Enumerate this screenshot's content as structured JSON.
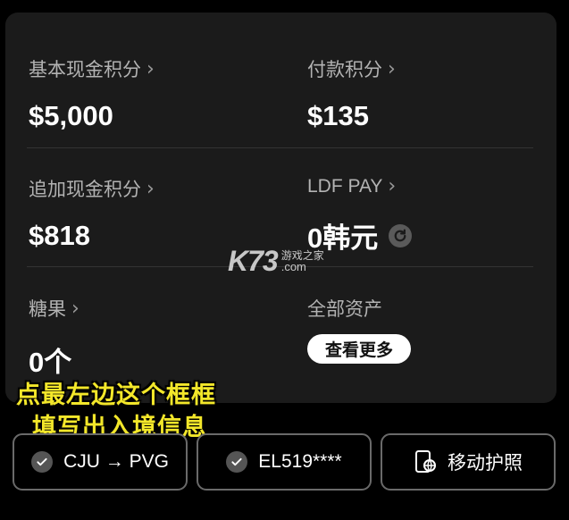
{
  "points": {
    "basic_cash": {
      "label": "基本现金积分",
      "value": "$5,000"
    },
    "payment": {
      "label": "付款积分",
      "value": "$135"
    },
    "additional_cash": {
      "label": "追加现金积分",
      "value": "$818"
    },
    "ldf_pay": {
      "label": "LDF PAY",
      "value": "0韩元"
    },
    "candy": {
      "label": "糖果",
      "value": "0个"
    },
    "all_assets": {
      "label": "全部资产",
      "button_label": "查看更多"
    }
  },
  "overlay": {
    "line1": "点最左边这个框框",
    "line2": "填写出入境信息"
  },
  "watermark": {
    "logo": "K73",
    "cn": "游戏之家",
    "com": ".com"
  },
  "buttons": {
    "route": {
      "label": "CJU → PVG"
    },
    "flight": {
      "label": "EL519****"
    },
    "passport": {
      "label": "移动护照"
    }
  },
  "colors": {
    "overlay_text": "#f3e72a",
    "card_bg": "#1b1b1b",
    "page_bg": "#000000"
  },
  "icons": {
    "chevron": "chevron-right-icon",
    "refresh": "refresh-icon",
    "check": "check-icon",
    "passport": "mobile-passport-icon"
  }
}
